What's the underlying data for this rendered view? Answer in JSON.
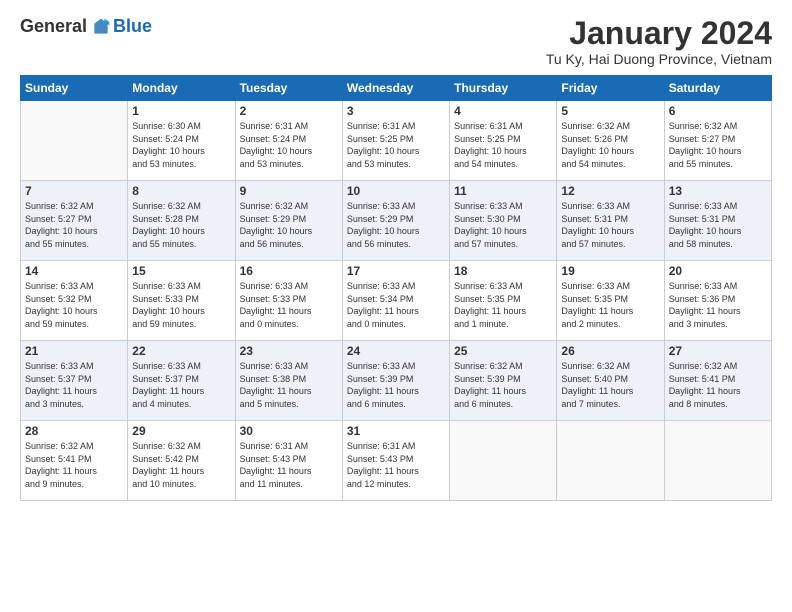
{
  "logo": {
    "general": "General",
    "blue": "Blue"
  },
  "header": {
    "title": "January 2024",
    "location": "Tu Ky, Hai Duong Province, Vietnam"
  },
  "weekdays": [
    "Sunday",
    "Monday",
    "Tuesday",
    "Wednesday",
    "Thursday",
    "Friday",
    "Saturday"
  ],
  "weeks": [
    [
      {
        "day": "",
        "info": ""
      },
      {
        "day": "1",
        "info": "Sunrise: 6:30 AM\nSunset: 5:24 PM\nDaylight: 10 hours\nand 53 minutes."
      },
      {
        "day": "2",
        "info": "Sunrise: 6:31 AM\nSunset: 5:24 PM\nDaylight: 10 hours\nand 53 minutes."
      },
      {
        "day": "3",
        "info": "Sunrise: 6:31 AM\nSunset: 5:25 PM\nDaylight: 10 hours\nand 53 minutes."
      },
      {
        "day": "4",
        "info": "Sunrise: 6:31 AM\nSunset: 5:25 PM\nDaylight: 10 hours\nand 54 minutes."
      },
      {
        "day": "5",
        "info": "Sunrise: 6:32 AM\nSunset: 5:26 PM\nDaylight: 10 hours\nand 54 minutes."
      },
      {
        "day": "6",
        "info": "Sunrise: 6:32 AM\nSunset: 5:27 PM\nDaylight: 10 hours\nand 55 minutes."
      }
    ],
    [
      {
        "day": "7",
        "info": "Sunrise: 6:32 AM\nSunset: 5:27 PM\nDaylight: 10 hours\nand 55 minutes."
      },
      {
        "day": "8",
        "info": "Sunrise: 6:32 AM\nSunset: 5:28 PM\nDaylight: 10 hours\nand 55 minutes."
      },
      {
        "day": "9",
        "info": "Sunrise: 6:32 AM\nSunset: 5:29 PM\nDaylight: 10 hours\nand 56 minutes."
      },
      {
        "day": "10",
        "info": "Sunrise: 6:33 AM\nSunset: 5:29 PM\nDaylight: 10 hours\nand 56 minutes."
      },
      {
        "day": "11",
        "info": "Sunrise: 6:33 AM\nSunset: 5:30 PM\nDaylight: 10 hours\nand 57 minutes."
      },
      {
        "day": "12",
        "info": "Sunrise: 6:33 AM\nSunset: 5:31 PM\nDaylight: 10 hours\nand 57 minutes."
      },
      {
        "day": "13",
        "info": "Sunrise: 6:33 AM\nSunset: 5:31 PM\nDaylight: 10 hours\nand 58 minutes."
      }
    ],
    [
      {
        "day": "14",
        "info": "Sunrise: 6:33 AM\nSunset: 5:32 PM\nDaylight: 10 hours\nand 59 minutes."
      },
      {
        "day": "15",
        "info": "Sunrise: 6:33 AM\nSunset: 5:33 PM\nDaylight: 10 hours\nand 59 minutes."
      },
      {
        "day": "16",
        "info": "Sunrise: 6:33 AM\nSunset: 5:33 PM\nDaylight: 11 hours\nand 0 minutes."
      },
      {
        "day": "17",
        "info": "Sunrise: 6:33 AM\nSunset: 5:34 PM\nDaylight: 11 hours\nand 0 minutes."
      },
      {
        "day": "18",
        "info": "Sunrise: 6:33 AM\nSunset: 5:35 PM\nDaylight: 11 hours\nand 1 minute."
      },
      {
        "day": "19",
        "info": "Sunrise: 6:33 AM\nSunset: 5:35 PM\nDaylight: 11 hours\nand 2 minutes."
      },
      {
        "day": "20",
        "info": "Sunrise: 6:33 AM\nSunset: 5:36 PM\nDaylight: 11 hours\nand 3 minutes."
      }
    ],
    [
      {
        "day": "21",
        "info": "Sunrise: 6:33 AM\nSunset: 5:37 PM\nDaylight: 11 hours\nand 3 minutes."
      },
      {
        "day": "22",
        "info": "Sunrise: 6:33 AM\nSunset: 5:37 PM\nDaylight: 11 hours\nand 4 minutes."
      },
      {
        "day": "23",
        "info": "Sunrise: 6:33 AM\nSunset: 5:38 PM\nDaylight: 11 hours\nand 5 minutes."
      },
      {
        "day": "24",
        "info": "Sunrise: 6:33 AM\nSunset: 5:39 PM\nDaylight: 11 hours\nand 6 minutes."
      },
      {
        "day": "25",
        "info": "Sunrise: 6:32 AM\nSunset: 5:39 PM\nDaylight: 11 hours\nand 6 minutes."
      },
      {
        "day": "26",
        "info": "Sunrise: 6:32 AM\nSunset: 5:40 PM\nDaylight: 11 hours\nand 7 minutes."
      },
      {
        "day": "27",
        "info": "Sunrise: 6:32 AM\nSunset: 5:41 PM\nDaylight: 11 hours\nand 8 minutes."
      }
    ],
    [
      {
        "day": "28",
        "info": "Sunrise: 6:32 AM\nSunset: 5:41 PM\nDaylight: 11 hours\nand 9 minutes."
      },
      {
        "day": "29",
        "info": "Sunrise: 6:32 AM\nSunset: 5:42 PM\nDaylight: 11 hours\nand 10 minutes."
      },
      {
        "day": "30",
        "info": "Sunrise: 6:31 AM\nSunset: 5:43 PM\nDaylight: 11 hours\nand 11 minutes."
      },
      {
        "day": "31",
        "info": "Sunrise: 6:31 AM\nSunset: 5:43 PM\nDaylight: 11 hours\nand 12 minutes."
      },
      {
        "day": "",
        "info": ""
      },
      {
        "day": "",
        "info": ""
      },
      {
        "day": "",
        "info": ""
      }
    ]
  ]
}
